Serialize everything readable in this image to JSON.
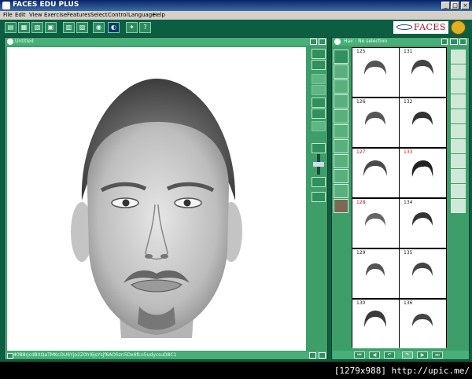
{
  "window": {
    "title": "FACES EDU PLUS",
    "min": "_",
    "max": "□",
    "close": "×"
  },
  "menu": [
    "File",
    "Edit",
    "View",
    "Exercise",
    "Features",
    "Select",
    "Control",
    "Language",
    "Help"
  ],
  "logo": {
    "text": "FACES"
  },
  "composite_panel": {
    "title": "Untitled",
    "code": "40B8rjcd8XQaTMKcDU6Yjo2Z0hl6jsYsjf6AOSzn5Dx6fLn5udycsuD8C1"
  },
  "feature_panel": {
    "title": "Hair : No selection",
    "items": [
      {
        "num": "125",
        "red": false
      },
      {
        "num": "131",
        "red": false
      },
      {
        "num": "126",
        "red": false
      },
      {
        "num": "132",
        "red": false
      },
      {
        "num": "127",
        "red": true
      },
      {
        "num": "133",
        "red": true
      },
      {
        "num": "128",
        "red": true
      },
      {
        "num": "134",
        "red": false
      },
      {
        "num": "129",
        "red": false
      },
      {
        "num": "135",
        "red": false
      },
      {
        "num": "130",
        "red": false
      },
      {
        "num": "136",
        "red": false
      }
    ]
  },
  "watermark": "[1279x988] http://upic.me/",
  "colors": {
    "panel": "#3e9e6a",
    "toolbar": "#0b5e42",
    "highlight_number": "#d01818"
  }
}
